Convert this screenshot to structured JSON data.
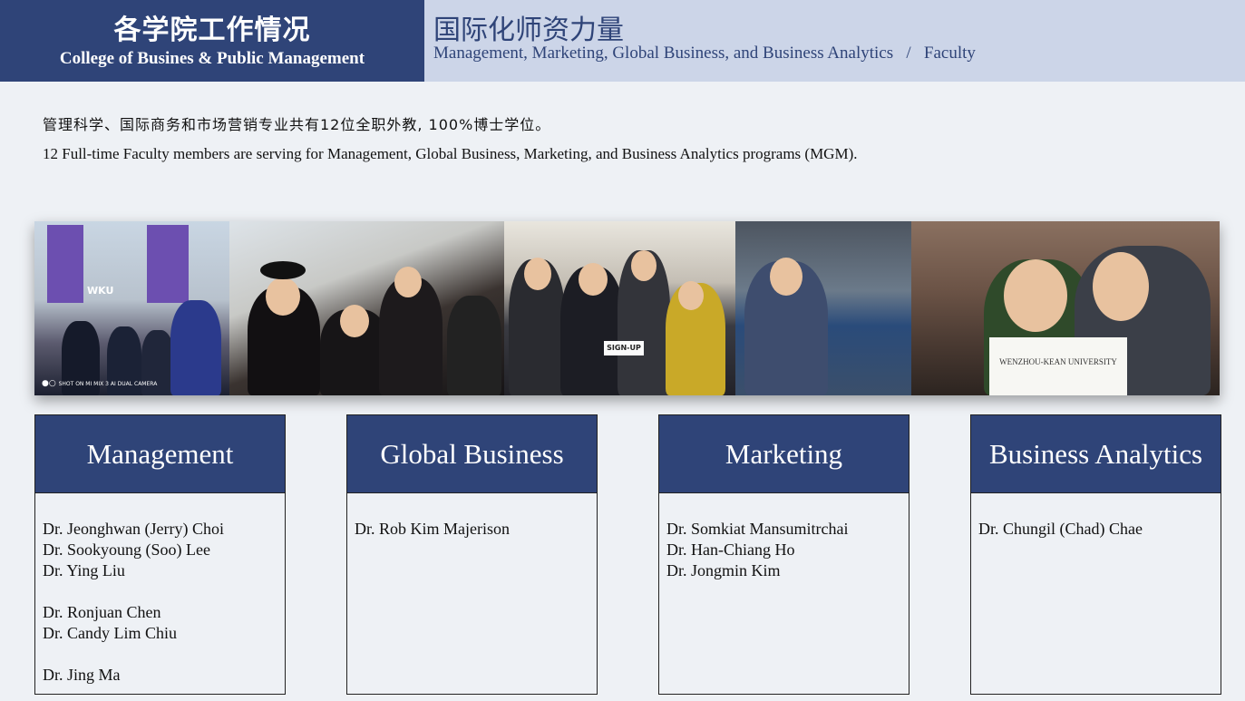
{
  "header": {
    "left_cn": "各学院工作情况",
    "left_en": "College of Busines & Public Management",
    "right_cn": "国际化师资力量",
    "right_en": "Management, Marketing, Global Business, and Business Analytics   /   Faculty"
  },
  "intro": {
    "cn": "管理科学、国际商务和市场营销专业共有12位全职外教, 100%博士学位。",
    "en": "12 Full-time Faculty members are serving for Management, Global Business, Marketing, and Business Analytics programs (MGM)."
  },
  "photos": {
    "p1_label": "WKU",
    "p1_camera": "SHOT ON MI MIX 3 AI DUAL CAMERA",
    "p3_sign": "SIGN-UP",
    "p5_paper": "WENZHOU-KEAN UNIVERSITY"
  },
  "cards": [
    {
      "title": "Management",
      "members": [
        "Dr. Jeonghwan (Jerry) Choi",
        "Dr. Sookyoung (Soo) Lee",
        "Dr. Ying Liu",
        "",
        "Dr. Ronjuan Chen",
        "Dr. Candy Lim Chiu",
        "",
        "Dr. Jing Ma"
      ]
    },
    {
      "title": "Global Business",
      "members": [
        "Dr. Rob Kim Majerison"
      ]
    },
    {
      "title": "Marketing",
      "members": [
        "Dr. Somkiat Mansumitrchai",
        "Dr. Han-Chiang Ho",
        "Dr. Jongmin Kim"
      ]
    },
    {
      "title": "Business Analytics",
      "members": [
        "Dr. Chungil (Chad) Chae"
      ]
    }
  ],
  "colors": {
    "navy": "#2f4478",
    "light_blue": "#ccd5e8",
    "background": "#eef1f5"
  }
}
